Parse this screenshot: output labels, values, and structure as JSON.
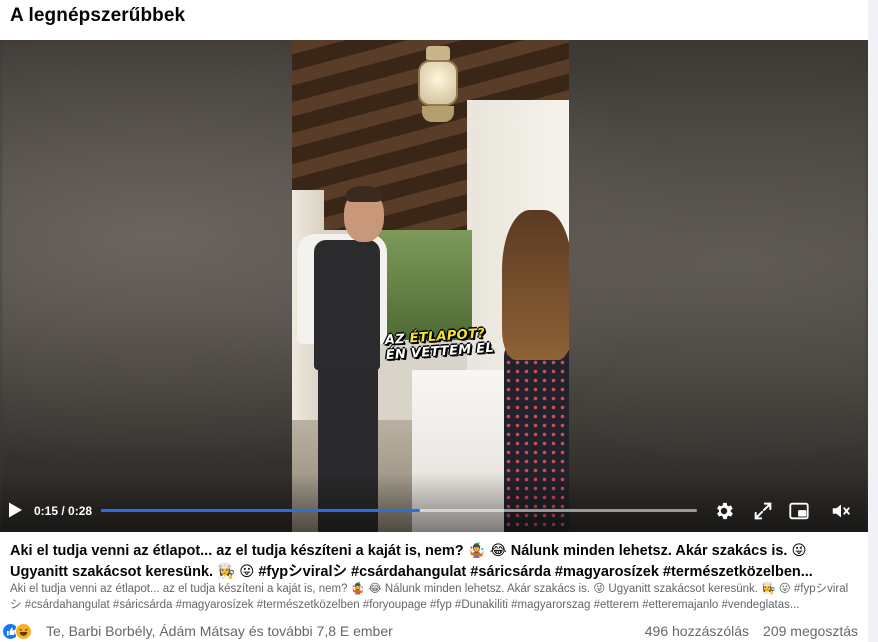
{
  "section": {
    "title": "A legnépszerűbbek"
  },
  "video": {
    "caption_line1_prefix": "AZ ",
    "caption_line1_highlight": "ÉTLAPOT?",
    "caption_line2": "ÉN VETTEM EL",
    "time": "0:15 / 0:28",
    "progress_fraction": 0.536,
    "accent_color": "#2d6be0",
    "icons": [
      "play-icon",
      "settings-gear-icon",
      "expand-icon",
      "picture-in-picture-icon",
      "volume-muted-icon"
    ]
  },
  "post": {
    "title_line1": "Aki el tudja venni az étlapot... az el tudja készíteni a kaját is, nem? 🤹 😂 Nálunk minden lehetsz. Akár szakács is. 😜",
    "title_line2": "Ugyanitt szakácsot keresünk. 👩‍🍳 😛 #fypシviralシ #csárdahangulat #sáricsárda #magyarosízek #természetközelben...",
    "description": "Aki el tudja venni az étlapot... az el tudja készíteni a kaját is, nem? 🤹 😂 Nálunk minden lehetsz. Akár szakács is. 😜 Ugyanitt szakácsot keresünk. 👩‍🍳 😛 #fypシviralシ #csárdahangulat #sáricsárda #magyarosízek #természetközelben #foryoupage #fyp #Dunakiliti #magyarorszag #etterem #etteremajanlo #vendeglatas..."
  },
  "footer": {
    "reactions": [
      "like",
      "haha"
    ],
    "reacted_by": "Te, Barbi Borbély, Ádám Mátsay és további 7,8 E ember",
    "comments": "496 hozzászólás",
    "shares": "209 megosztás"
  }
}
